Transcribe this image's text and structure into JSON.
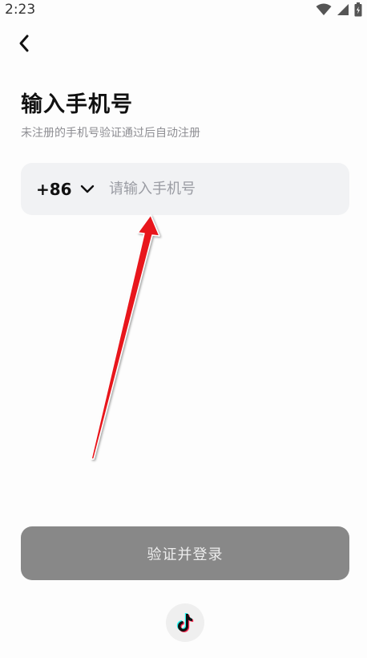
{
  "status_bar": {
    "time": "2:23",
    "icons": [
      "wifi-icon",
      "signal-icon",
      "battery-icon"
    ]
  },
  "header": {
    "back_icon": "chevron-left-icon"
  },
  "main": {
    "title": "输入手机号",
    "subtitle": "未注册的手机号验证通过后自动注册",
    "phone": {
      "country_code": "+86",
      "dropdown_icon": "chevron-down-icon",
      "placeholder": "请输入手机号",
      "value": ""
    },
    "submit_label": "验证并登录",
    "third_party_icon": "tiktok-icon"
  },
  "colors": {
    "input_bg": "#f1f2f4",
    "button_disabled_bg": "#888888",
    "annotation_arrow": "#e8141b"
  }
}
